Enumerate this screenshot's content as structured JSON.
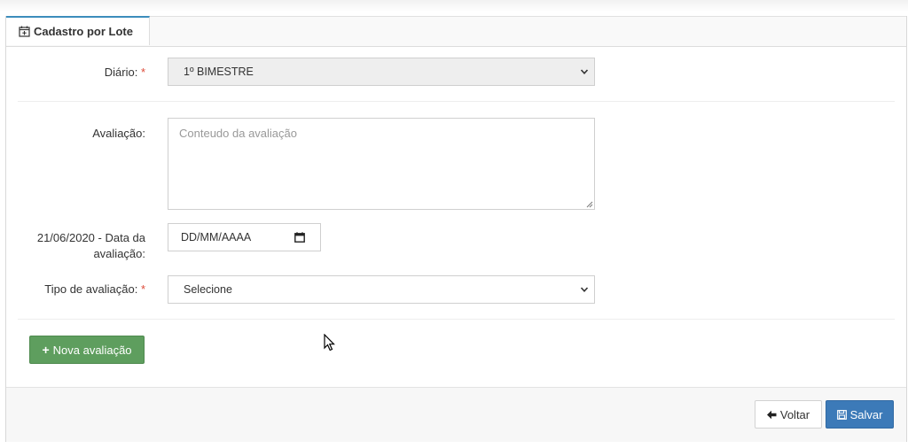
{
  "tab": {
    "label": "Cadastro por Lote",
    "icon": "calendar-plus-icon"
  },
  "form": {
    "diario": {
      "label": "Diário:",
      "required_mark": "*",
      "value": "1º BIMESTRE"
    },
    "avaliacao": {
      "label": "Avaliação:",
      "placeholder": "Conteudo da avaliação"
    },
    "data": {
      "label_line1": "21/06/2020 - Data da",
      "label_line2": "avaliação:",
      "placeholder": "DD/MM/AAAA"
    },
    "tipo": {
      "label": "Tipo de avaliação:",
      "required_mark": "*",
      "value": "Selecione"
    }
  },
  "actions": {
    "nova_avaliacao": "Nova avaliação",
    "voltar": "Voltar",
    "salvar": "Salvar"
  },
  "colors": {
    "accent": "#3c8dbc",
    "success": "#5e9e5e",
    "primary": "#3c7ab8",
    "required": "#dd4b39"
  }
}
